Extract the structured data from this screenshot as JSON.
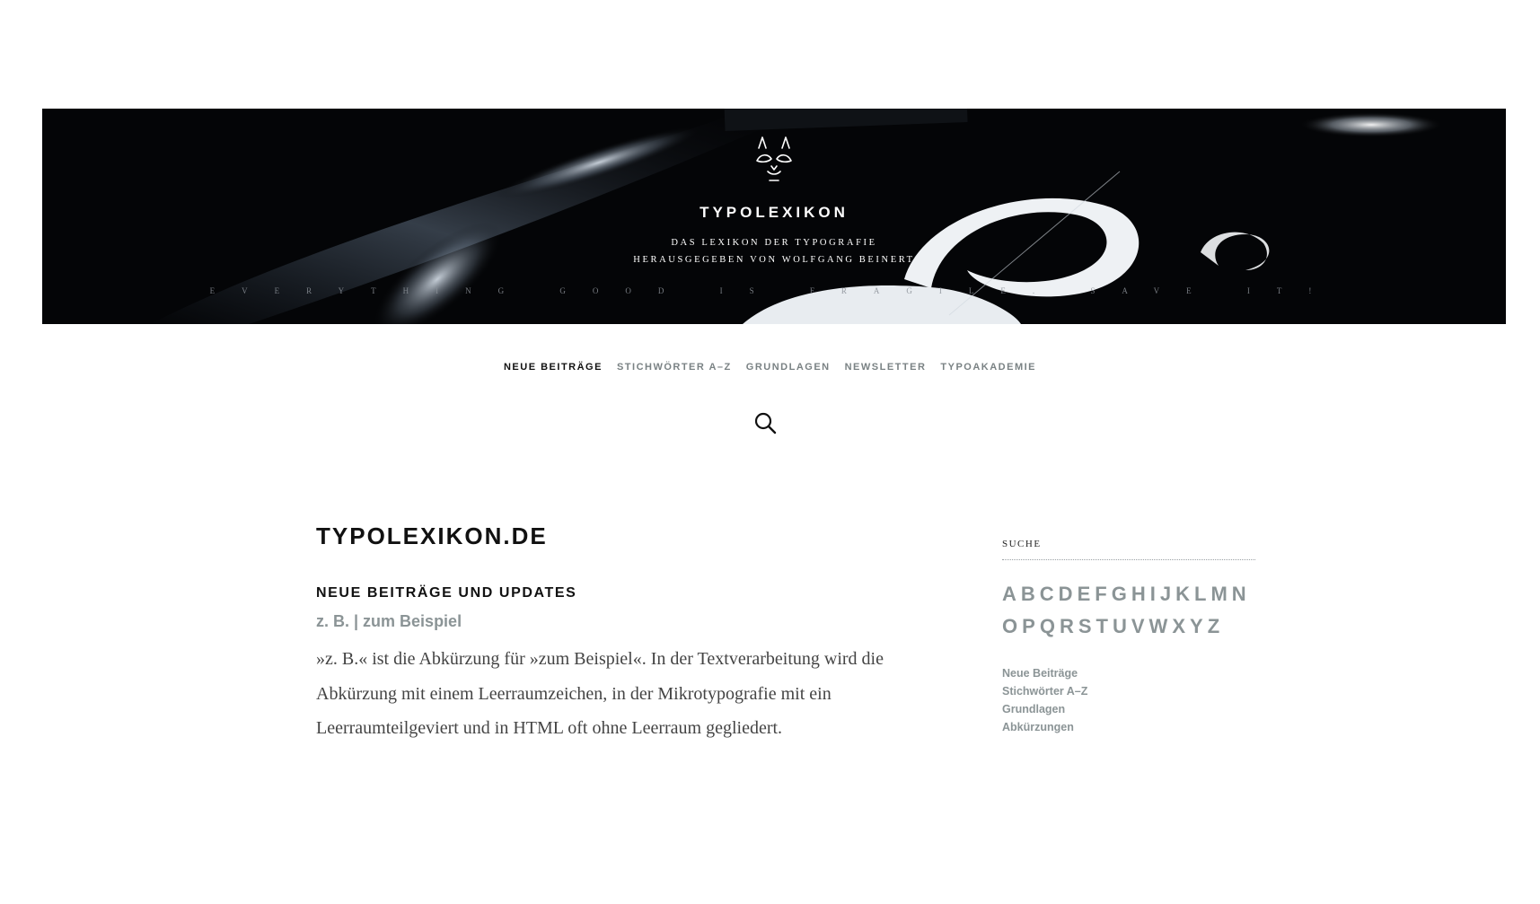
{
  "header": {
    "site_title": "TYPOLEXIKON",
    "tagline_line1": "DAS LEXIKON DER TYPOGRAFIE",
    "tagline_line2": "HERAUSGEGEBEN VON WOLFGANG BEINERT",
    "motto": "EVERYTHING GOOD IS FRAGILE. SAVE IT!",
    "logo_icon": "cat-face-logo-icon"
  },
  "nav": {
    "items": [
      {
        "label": "NEUE BEITRÄGE",
        "active": true
      },
      {
        "label": "STICHWÖRTER A–Z",
        "active": false
      },
      {
        "label": "GRUNDLAGEN",
        "active": false
      },
      {
        "label": "NEWSLETTER",
        "active": false
      },
      {
        "label": "TYPOAKADEMIE",
        "active": false
      }
    ],
    "search_icon": "search-icon"
  },
  "main": {
    "page_title": "TYPOLEXIKON.DE",
    "section_title": "NEUE BEITRÄGE UND UPDATES",
    "post": {
      "title": "z. B. | zum Beispiel",
      "excerpt": "»z. B.« ist die Abkürzung für »zum Beispiel«. In der Textverarbeitung wird die Abkürzung mit einem Leerraumzeichen, in der Mikrotypografie mit ein Leerraumteilgeviert und in HTML oft ohne Leerraum gegliedert."
    }
  },
  "sidebar": {
    "widget_title": "SUCHE",
    "alphabet": [
      "A",
      "B",
      "C",
      "D",
      "E",
      "F",
      "G",
      "H",
      "I",
      "J",
      "K",
      "L",
      "M",
      "N",
      "O",
      "P",
      "Q",
      "R",
      "S",
      "T",
      "U",
      "V",
      "W",
      "X",
      "Y",
      "Z"
    ],
    "links": [
      "Neue Beiträge",
      "Stichwörter A–Z",
      "Grundlagen",
      "Abkürzungen"
    ]
  },
  "colors": {
    "accent_gray": "#8b9496",
    "text_dark": "#111111",
    "banner_bg": "#050608"
  }
}
